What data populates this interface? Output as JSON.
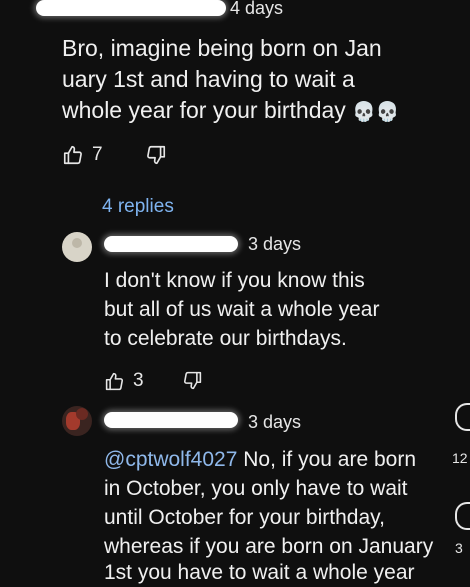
{
  "comment1": {
    "time": "4 days",
    "lines": [
      "Bro, imagine being born on Jan",
      "uary 1st and having to wait a",
      "whole year for your birthday"
    ],
    "emoji": "💀💀",
    "likes": "7",
    "replies_link": "4 replies"
  },
  "reply1": {
    "time": "3 days",
    "lines": [
      "I don't know if you know this",
      "but all of us wait a whole year",
      "to celebrate our birthdays."
    ],
    "likes": "3"
  },
  "reply2": {
    "time": "3 days",
    "mention": "@cptwolf4027",
    "line1_rest": " No, if you are born",
    "lines": [
      "in October, you only have to wait",
      "until October for your birthday,",
      "whereas if you are born on January",
      "1st you have to wait a whole year"
    ]
  },
  "edge_numbers": [
    "12",
    "3"
  ],
  "icons": {
    "like": "thumbs-up-icon",
    "dislike": "thumbs-down-icon",
    "skull": "skull-emoji-icon"
  }
}
